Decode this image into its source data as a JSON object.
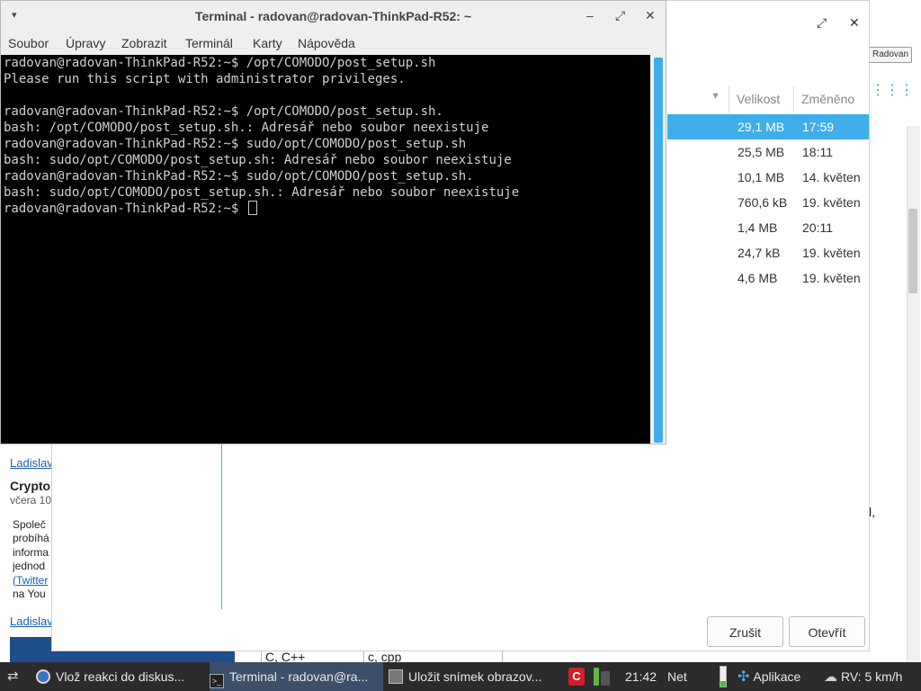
{
  "terminal": {
    "title": "Terminal - radovan@radovan-ThinkPad-R52: ~",
    "menu": [
      "Soubor",
      "Úpravy",
      "Zobrazit",
      "Terminál",
      "Karty",
      "Nápověda"
    ],
    "lines": [
      "radovan@radovan-ThinkPad-R52:~$ /opt/COMODO/post_setup.sh",
      "Please run this script with administrator privileges.",
      "",
      "radovan@radovan-ThinkPad-R52:~$ /opt/COMODO/post_setup.sh.",
      "bash: /opt/COMODO/post_setup.sh.: Adresář nebo soubor neexistuje",
      "radovan@radovan-ThinkPad-R52:~$ sudo/opt/COMODO/post_setup.sh",
      "bash: sudo/opt/COMODO/post_setup.sh: Adresář nebo soubor neexistuje",
      "radovan@radovan-ThinkPad-R52:~$ sudo/opt/COMODO/post_setup.sh.",
      "bash: sudo/opt/COMODO/post_setup.sh.: Adresář nebo soubor neexistuje",
      "radovan@radovan-ThinkPad-R52:~$ "
    ],
    "controls": {
      "menu": "▾",
      "minimize": "–",
      "maximize": "⤢",
      "close": "✕"
    }
  },
  "dialog": {
    "controls": {
      "maximize": "⤢",
      "close": "✕"
    },
    "columns": {
      "size": "Velikost",
      "modified": "Změněno"
    },
    "rows": [
      {
        "size": "29,1 MB",
        "modified": "17:59",
        "selected": true
      },
      {
        "size": "25,5 MB",
        "modified": "18:11"
      },
      {
        "size": "10,1 MB",
        "modified": "14. květen"
      },
      {
        "size": "760,6 kB",
        "modified": "19. květen"
      },
      {
        "size": "1,4 MB",
        "modified": "20:11"
      },
      {
        "size": "24,7 kB",
        "modified": "19. květen"
      },
      {
        "size": "4,6 MB",
        "modified": "19. květen"
      }
    ],
    "cancel_label": "Zrušit",
    "open_label": "Otevřít",
    "accent_color": "#3daee9"
  },
  "browser": {
    "user_button": "Radovan",
    "left": {
      "author_link_1": "Ladislav",
      "heading": "Crypto",
      "date": "včera 10",
      "text": [
        "Společ",
        "probíhá",
        "informa",
        "jednod",
        "(Twitter",
        "na You"
      ],
      "author_link_2": "Ladislav"
    },
    "right_fragment": "l,",
    "table_cells": [
      "C, C++",
      "c, cpp"
    ]
  },
  "taskbar": {
    "tasks": [
      {
        "label": "Vlož reakci do diskus...",
        "icon": "chrome-icon",
        "active": false
      },
      {
        "label": "Terminal - radovan@ra...",
        "icon": "terminal-icon",
        "active": true
      },
      {
        "label": "Uložit snímek obrazov...",
        "icon": "screenshot-icon",
        "active": false
      }
    ],
    "clock": "21:42",
    "net": "Net",
    "apps": "Aplikace",
    "weather": "RV: 5 km/h"
  }
}
